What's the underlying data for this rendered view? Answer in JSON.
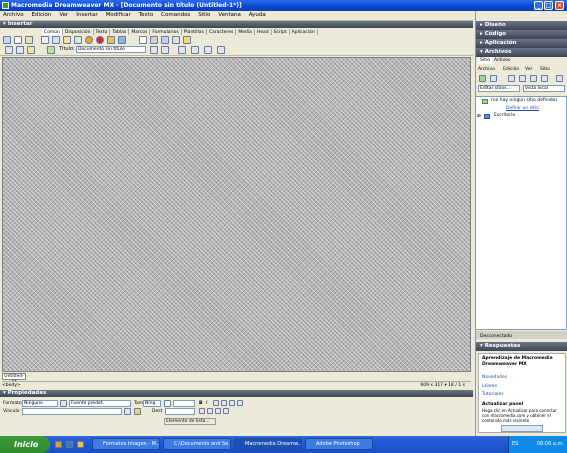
{
  "window": {
    "title": "Macromedia Dreamweaver MX - [Documento sin título (Untitled-1*)]"
  },
  "menu": [
    "Archivo",
    "Edición",
    "Ver",
    "Insertar",
    "Modificar",
    "Texto",
    "Comandos",
    "Sitio",
    "Ventana",
    "Ayuda"
  ],
  "insert_panel": {
    "title": "Insertar",
    "tabs": [
      "Común",
      "Disposición",
      "Texto",
      "Tablas",
      "Marcos",
      "Formularios",
      "Plantillas",
      "Caracteres",
      "Media",
      "Head",
      "Script",
      "Aplicación"
    ]
  },
  "document_toolbar": {
    "title_label": "Título:",
    "title_value": "Documento sin título"
  },
  "document": {
    "tab": "Untitled-1*",
    "status_tag": "<body>",
    "status_size": "609 x 317 ▾ 1K / 1 s"
  },
  "properties": {
    "title": "Propiedades",
    "format_label": "Formato",
    "format_value": "Ninguno",
    "font_value": "Fuente predet.",
    "size_label": "Tam",
    "size_value": "Ning",
    "link_label": "Vínculo",
    "target_label": "Dest",
    "page_props": "Elemento de lista..."
  },
  "right_panels": {
    "diseno": "Diseño",
    "codigo": "Código",
    "aplicacion": "Aplicación",
    "archivos": "Archivos",
    "files_tabs": [
      "Sitio",
      "Activos"
    ],
    "files_menu": [
      "Archivo",
      "Edición",
      "Ver",
      "Sitio"
    ],
    "site_select": "Editar sitios...",
    "view_select": "Vista local",
    "tree_items": [
      "(no hay ningún sitio definido)",
      "Definir un sitio",
      "Escritorio"
    ],
    "status": "Desconectado",
    "respuestas": "Respuestas",
    "answers_title": "Aprendizaje de Macromedia Dreamweaver MX",
    "answers_links": [
      "Novedades",
      "Léame",
      "Tutoriales"
    ],
    "update_title": "Actualizar panel",
    "update_text": "Haga clic en Actualizar para conectar con macromedia.com y obtener el contenido más reciente"
  },
  "taskbar": {
    "start": "Inicio",
    "buttons": [
      "Formatos Imagen - M...",
      "C:\\Documents and Se...",
      "Macromedia Dreamw...",
      "Adobe Photoshop"
    ],
    "tray_lang": "ES",
    "clock": "08:08 a.m."
  }
}
